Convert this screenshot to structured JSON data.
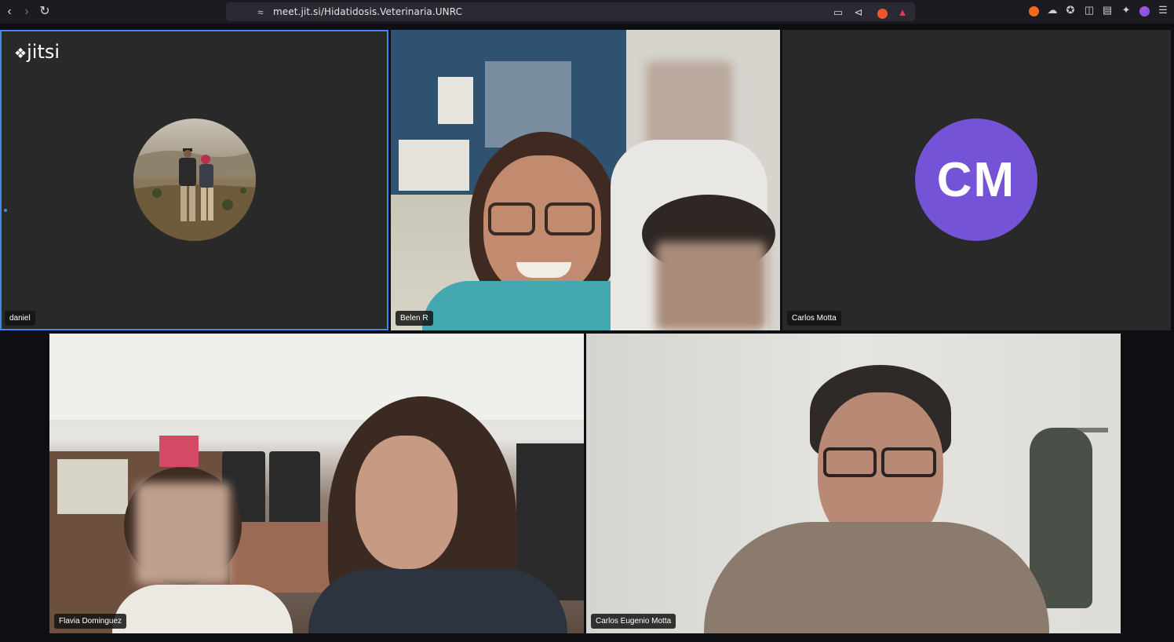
{
  "browser": {
    "url": "meet.jit.si/Hidatidosis.Veterinaria.UNRC",
    "back_icon": "back-arrow-icon",
    "forward_icon": "forward-arrow-icon",
    "reload_icon": "reload-icon"
  },
  "meeting": {
    "logo_text": "jitsi",
    "participants": [
      {
        "name": "daniel",
        "type": "photo-avatar",
        "active": true
      },
      {
        "name": "Belen R",
        "type": "video"
      },
      {
        "name": "Carlos Motta",
        "type": "initials",
        "initials": "CM",
        "color": "#7553d6"
      },
      {
        "name": "Flavia Dominguez",
        "type": "video"
      },
      {
        "name": "Carlos Eugenio Motta",
        "type": "video"
      }
    ]
  },
  "colors": {
    "accent": "#4687ed",
    "tile_bg": "#292929",
    "avatar_bg": "#7553d6"
  }
}
